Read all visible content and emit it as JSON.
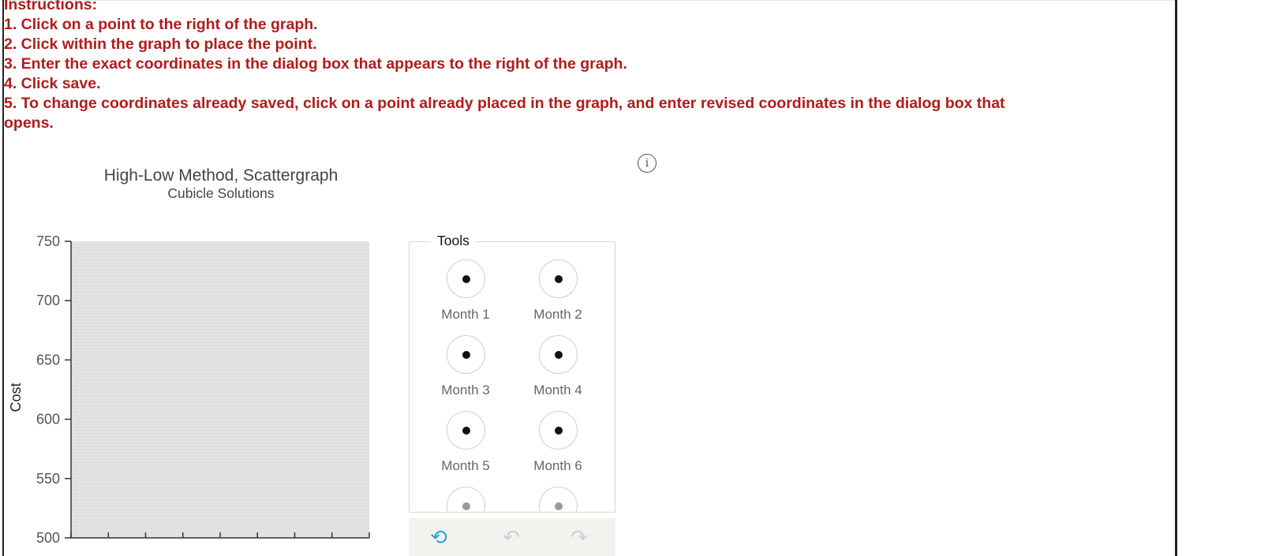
{
  "instructions": {
    "heading": "Instructions:",
    "steps": [
      "1. Click on a point to the right of the graph.",
      "2. Click within the graph to place the point.",
      "3. Enter the exact coordinates in the dialog box that appears to the right of the graph.",
      "4. Click save.",
      "5. To change coordinates already saved, click on a point already placed in the graph, and enter revised coordinates in the dialog box that opens."
    ]
  },
  "info_icon": {
    "glyph": "i",
    "icon": "info-icon"
  },
  "chart_data": {
    "type": "scatter",
    "title": "High-Low Method, Scattergraph",
    "subtitle": "Cubicle Solutions",
    "ylabel": "Cost",
    "xlabel": "",
    "y_ticks": [
      "750",
      "700",
      "650",
      "600",
      "550",
      "500"
    ],
    "ylim": [
      500,
      750
    ],
    "x_tick_count": 9,
    "series": [],
    "grid": true,
    "plot_background": "#e3e3e3"
  },
  "tools": {
    "label": "Tools",
    "items": [
      {
        "label": "Month 1"
      },
      {
        "label": "Month 2"
      },
      {
        "label": "Month 3"
      },
      {
        "label": "Month 4"
      },
      {
        "label": "Month 5"
      },
      {
        "label": "Month 6"
      }
    ],
    "actions": [
      {
        "icon": "reset-icon",
        "glyph": "⟲",
        "color": "#2aa7d6"
      },
      {
        "icon": "undo-icon",
        "glyph": "↶",
        "color": "#cfcfcf"
      },
      {
        "icon": "redo-icon",
        "glyph": "↷",
        "color": "#cfcfcf"
      }
    ]
  },
  "colors": {
    "instruction_text": "#b01c1c",
    "border": "#222222"
  }
}
